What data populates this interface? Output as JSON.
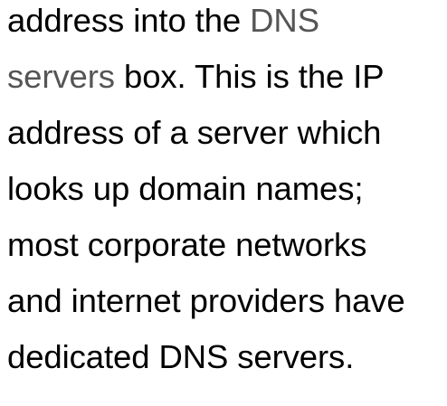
{
  "paragraph": {
    "lines": [
      {
        "pre": "address into the ",
        "ui": "DNS",
        "post": ""
      },
      {
        "pre": "",
        "ui": "servers",
        "post": " box. This is the IP"
      },
      {
        "pre": "address of a server which",
        "ui": "",
        "post": ""
      },
      {
        "pre": "looks up domain names;",
        "ui": "",
        "post": ""
      },
      {
        "pre": "most corporate networks",
        "ui": "",
        "post": ""
      },
      {
        "pre": "and internet providers have",
        "ui": "",
        "post": ""
      },
      {
        "pre": "dedicated DNS servers.",
        "ui": "",
        "post": ""
      }
    ]
  },
  "colors": {
    "body_text": "#000000",
    "ui_label_text": "#555555",
    "background": "#ffffff"
  }
}
